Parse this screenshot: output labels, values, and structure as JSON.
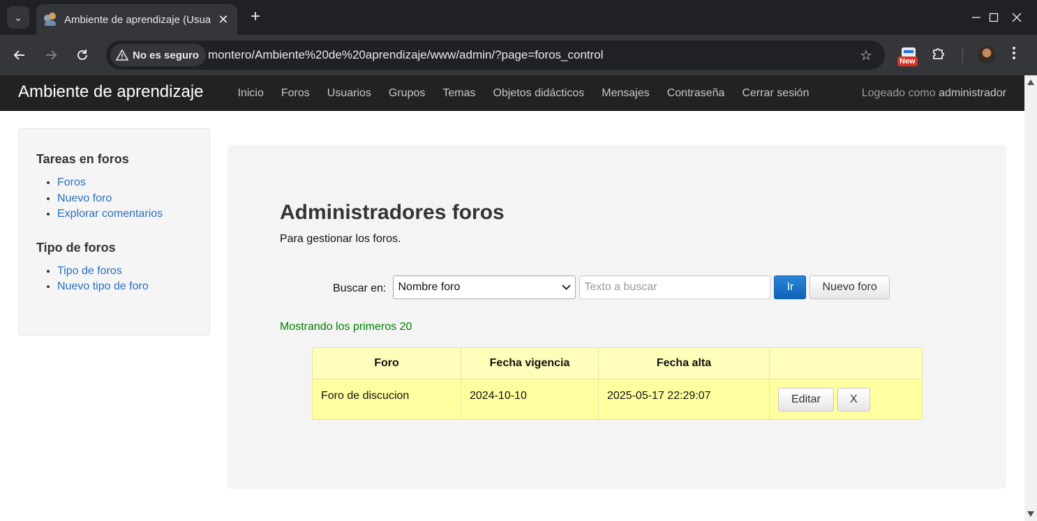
{
  "browser": {
    "tab_title": "Ambiente de aprendizaje (Usuarios)",
    "tab_close": "✕",
    "new_tab": "+",
    "security_label": "No es seguro",
    "url": "montero/Ambiente%20de%20aprendizaje/www/admin/?page=foros_control",
    "extension_badge": "New",
    "icons": [
      "chevron-down-icon",
      "close-icon",
      "plus-icon",
      "minimize-icon",
      "maximize-icon",
      "back-icon",
      "forward-icon",
      "reload-icon",
      "warning-icon",
      "star-icon",
      "extension-icon",
      "puzzle-icon",
      "avatar",
      "more-icon"
    ]
  },
  "navbar": {
    "brand": "Ambiente de aprendizaje",
    "links": [
      "Inicio",
      "Foros",
      "Usuarios",
      "Grupos",
      "Temas",
      "Objetos didácticos",
      "Mensajes",
      "Contraseña",
      "Cerrar sesión"
    ],
    "logged_prefix": "Logeado como",
    "logged_user": "administrador"
  },
  "sidebar": {
    "section1_title": "Tareas en foros",
    "section1_items": [
      "Foros",
      "Nuevo foro",
      "Explorar comentarios"
    ],
    "section2_title": "Tipo de foros",
    "section2_items": [
      "Tipo de foros",
      "Nuevo tipo de foro"
    ]
  },
  "main": {
    "title": "Administradores foros",
    "subtitle": "Para gestionar los foros.",
    "search_label": "Buscar en:",
    "select_value": "Nombre foro",
    "search_placeholder": "Texto a buscar",
    "go_button": "Ir",
    "new_button": "Nuevo foro",
    "showing": "Mostrando los primeros 20",
    "table": {
      "headers": [
        "Foro",
        "Fecha vigencia",
        "Fecha alta",
        ""
      ],
      "rows": [
        {
          "foro": "Foro de discucion",
          "vigencia": "2024-10-10",
          "alta": "2025-05-17 22:29:07",
          "edit": "Editar",
          "delete": "X"
        }
      ]
    }
  },
  "colors": {
    "navbar_bg": "#222222",
    "link": "#2a6fbf",
    "primary_button": "#0f62b8",
    "showing_text": "#008000",
    "table_bg": "#ffffa0"
  }
}
